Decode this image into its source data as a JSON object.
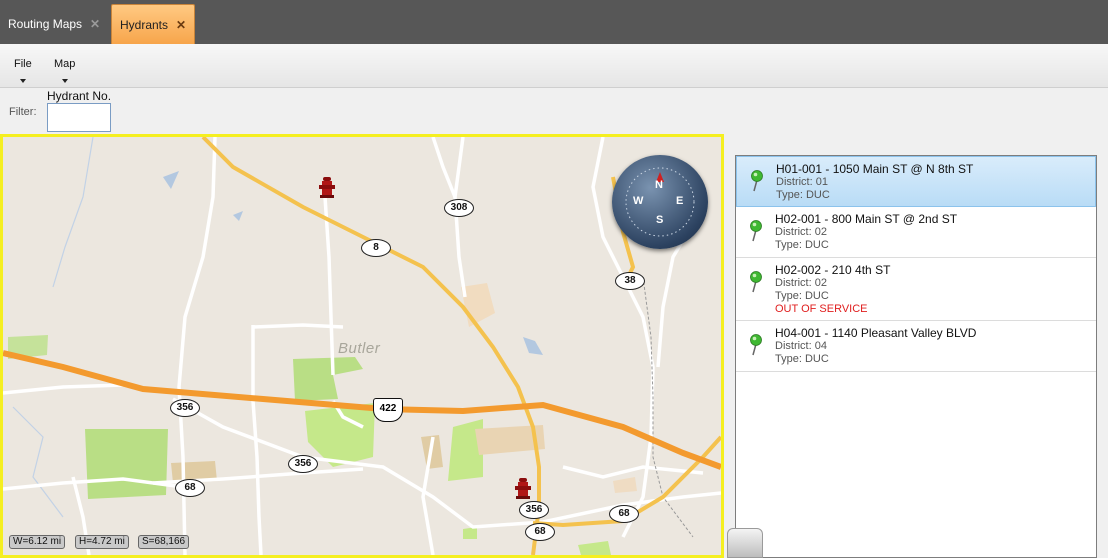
{
  "tabs": [
    {
      "label": "Routing Maps",
      "active": false
    },
    {
      "label": "Hydrants",
      "active": true
    }
  ],
  "menu": [
    {
      "label": "File"
    },
    {
      "label": "Map"
    }
  ],
  "filter": {
    "label": "Filter:",
    "field_label": "Hydrant No.",
    "value": ""
  },
  "map": {
    "city_label": "Butler",
    "roads": {
      "r308": "308",
      "r8": "8",
      "r38": "38",
      "us422": "422",
      "r356a": "356",
      "r356b": "356",
      "r356c": "356",
      "r68a": "68",
      "r68b": "68",
      "r68c": "68"
    },
    "compass": {
      "n": "N",
      "e": "E",
      "s": "S",
      "w": "W"
    },
    "scale": {
      "width": "W=6.12 mi",
      "height": "H=4.72 mi",
      "scale": "S=68,166"
    }
  },
  "hydrants": [
    {
      "title": "H01-001 - 1050 Main ST  @ N 8th ST",
      "district": "District: 01",
      "type": "Type: DUC",
      "status": ""
    },
    {
      "title": "H02-001 - 800 Main ST  @ 2nd ST",
      "district": "District: 02",
      "type": "Type: DUC",
      "status": ""
    },
    {
      "title": "H02-002 - 210 4th ST",
      "district": "District: 02",
      "type": "Type: DUC",
      "status": "OUT OF SERVICE"
    },
    {
      "title": "H04-001 - 1140 Pleasant Valley BLVD",
      "district": "District: 04",
      "type": "Type: DUC",
      "status": ""
    }
  ],
  "colors": {
    "accent_tab": "#f7a54b",
    "map_border": "#f5ef20",
    "highway": "#f39a2e",
    "primary_road": "#f4c24e",
    "selected_row": "#c4e2f8",
    "out_of_service": "#e02020"
  }
}
